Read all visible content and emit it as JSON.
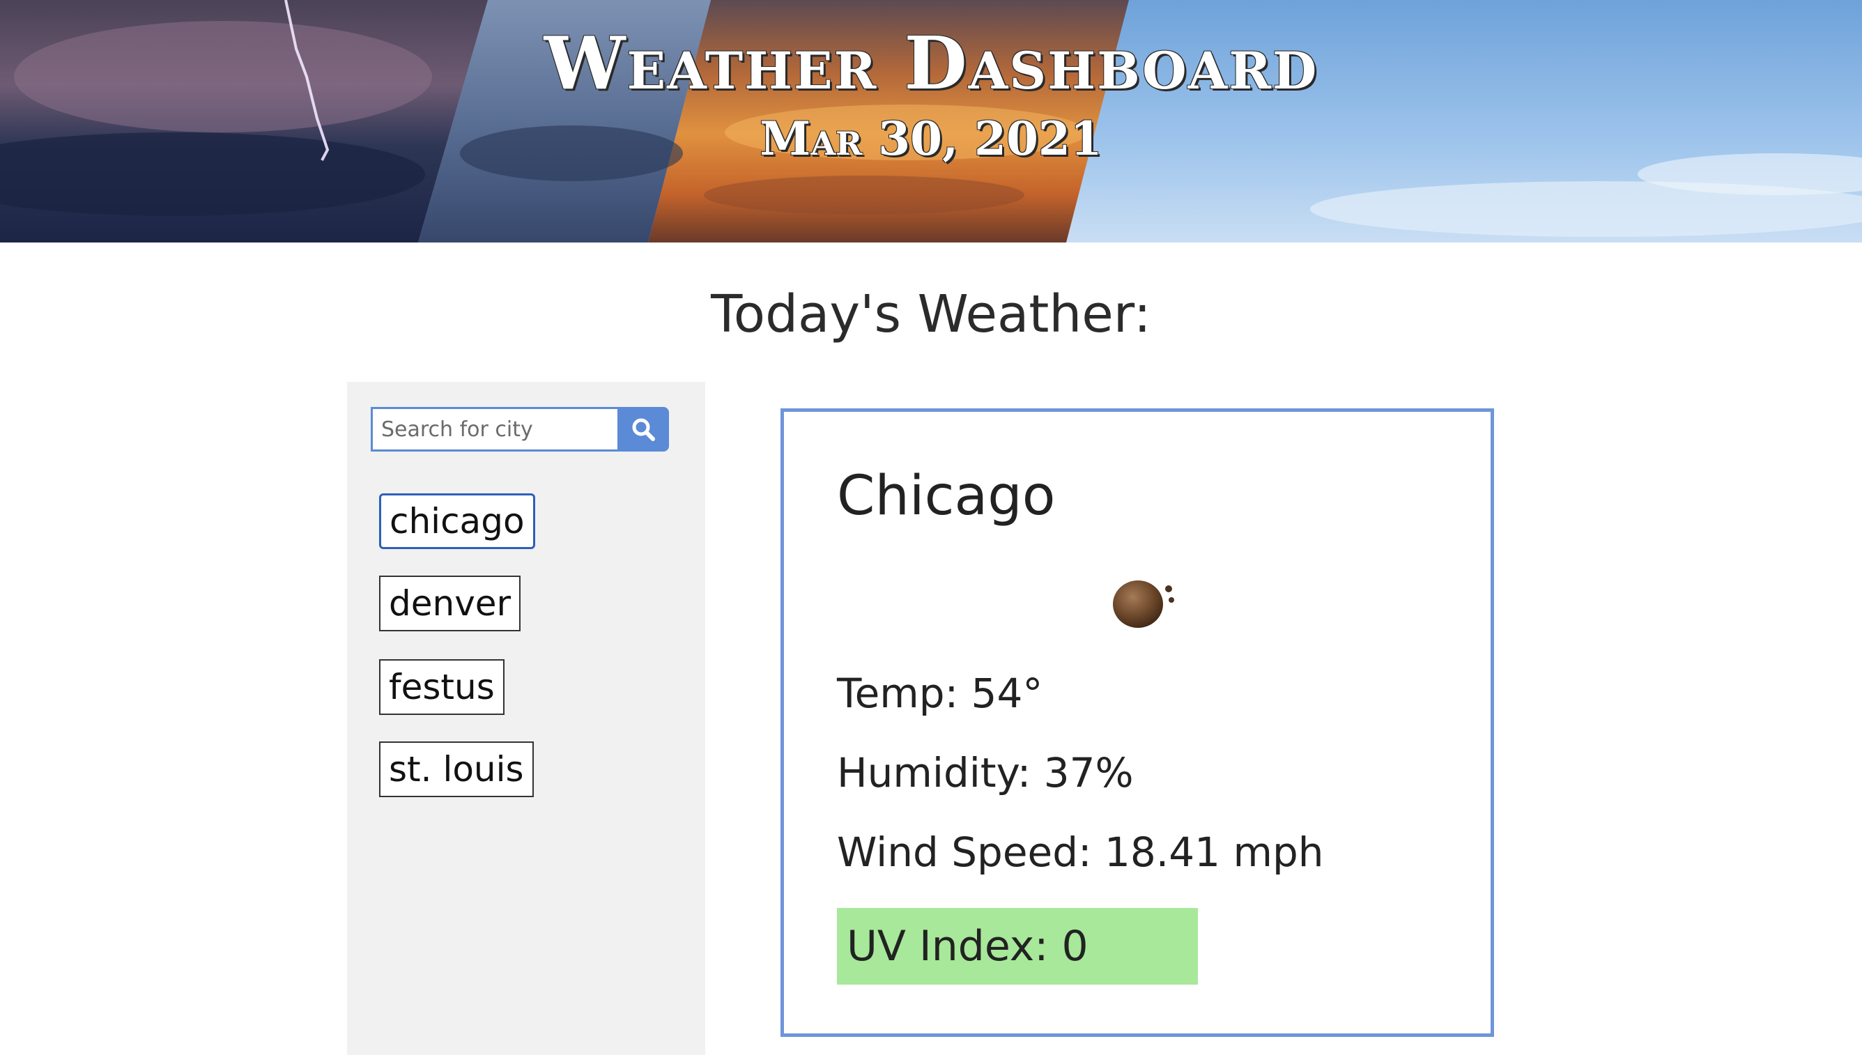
{
  "header": {
    "title": "Weather Dashboard",
    "date": "Mar 30, 2021"
  },
  "section": {
    "heading": "Today's Weather:"
  },
  "search": {
    "placeholder": "Search for city",
    "value": "",
    "button_icon": "search-icon"
  },
  "history": {
    "cities": [
      "chicago",
      "denver",
      "festus",
      "st. louis"
    ],
    "active_index": 0
  },
  "current": {
    "city": "Chicago",
    "icon": "overcast-cloud-icon",
    "temp": "Temp: 54°",
    "humidity": "Humidity: 37%",
    "wind": "Wind Speed: 18.41 mph",
    "uv": "UV Index: 0",
    "uv_color": "#a7e89a"
  },
  "colors": {
    "accent": "#5b8ad6",
    "card_border": "#6f95da",
    "active_city_border": "#2f5fb8",
    "sidebar_bg": "#f1f1f1"
  }
}
